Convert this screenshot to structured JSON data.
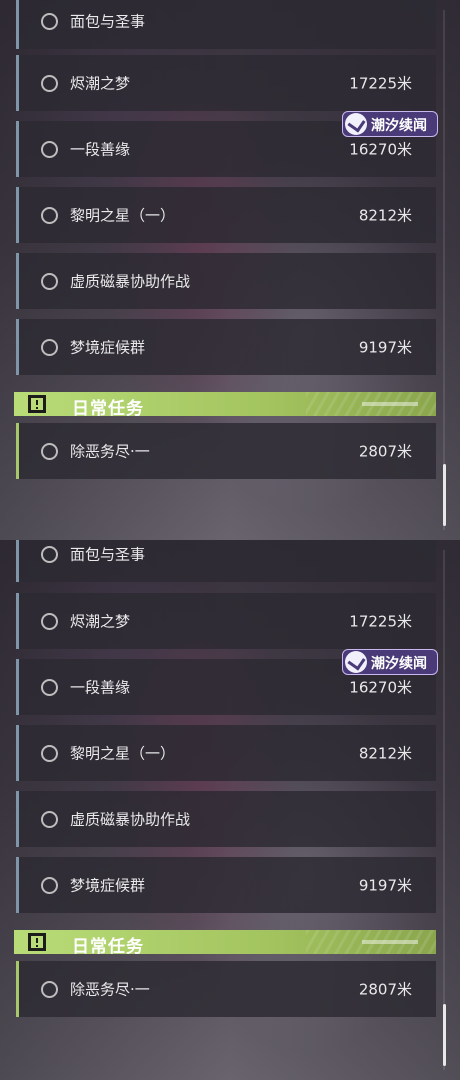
{
  "quests": [
    {
      "name": "面包与圣事",
      "distance": ""
    },
    {
      "name": "烬潮之梦",
      "distance": "17225米"
    },
    {
      "name": "一段善缘",
      "distance": "16270米"
    },
    {
      "name": "黎明之星（一）",
      "distance": "8212米"
    },
    {
      "name": "虚质磁暴协助作战",
      "distance": ""
    },
    {
      "name": "梦境症候群",
      "distance": "9197米"
    }
  ],
  "daily_section": {
    "title": "日常任务",
    "icon": "exclamation-icon",
    "quests": [
      {
        "name": "除恶务尽·一",
        "distance": "2807米"
      }
    ]
  },
  "badge": {
    "text": "潮汐续闻",
    "icon": "tide-logo-icon"
  },
  "colors": {
    "quest_accent": "#7f96a8",
    "daily_accent": "#a7c86a",
    "section_green": "#b9dc78",
    "badge_purple": "#4a3a78"
  }
}
